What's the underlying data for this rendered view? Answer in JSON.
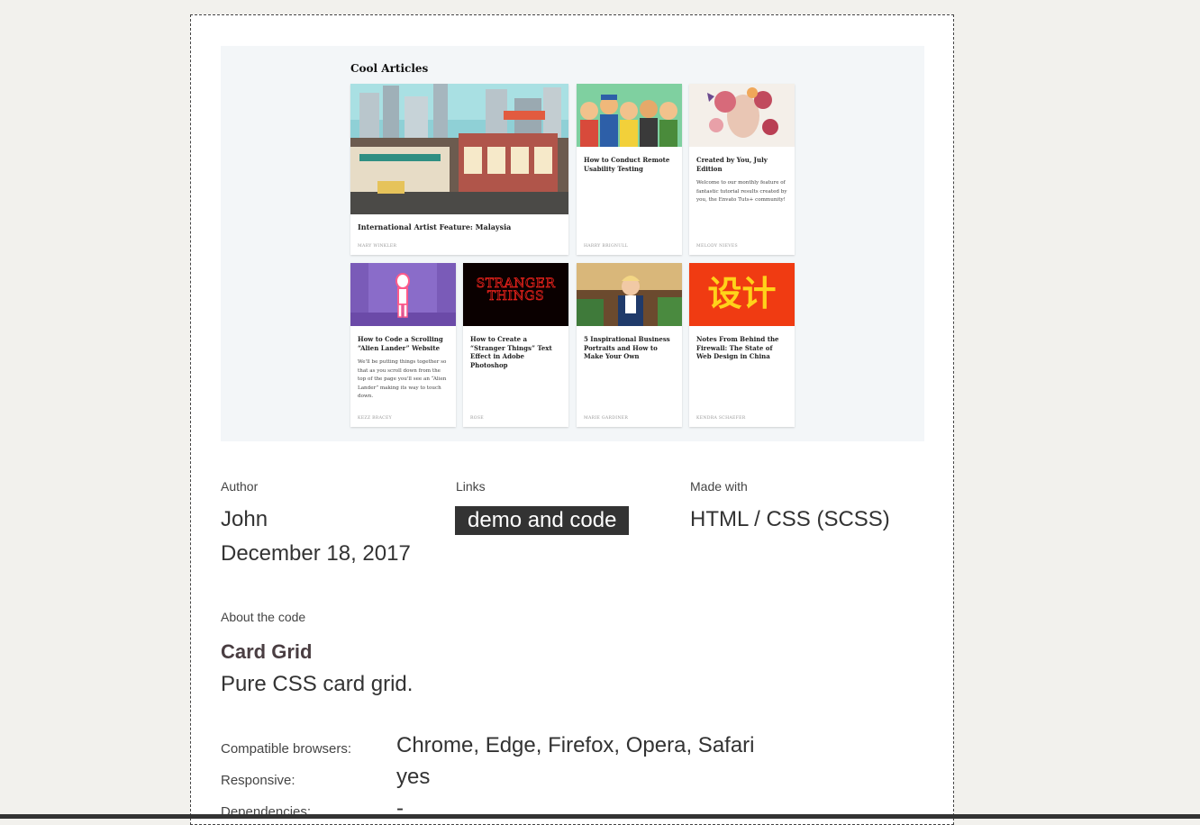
{
  "preview": {
    "heading": "Cool Articles",
    "cards": [
      {
        "title": "International Artist Feature: Malaysia",
        "description": "",
        "author": "MARY WINKLER",
        "image": "city-illustration"
      },
      {
        "title": "How to Conduct Remote Usability Testing",
        "description": "",
        "author": "HARRY BRIGNULL",
        "image": "cartoon-people"
      },
      {
        "title": "Created by You, July Edition",
        "description": "Welcome to our monthly feature of fantastic tutorial results created by you, the Envato Tuts+ community!",
        "author": "MELODY NIEVES",
        "image": "floral-portrait"
      },
      {
        "title": "How to Code a Scrolling “Alien Lander” Website",
        "description": "We'll be putting things together so that as you scroll down from the top of the page you'll see an “Alien Lander” making its way to touch down.",
        "author": "KEZZ BRACEY",
        "image": "alien-figure"
      },
      {
        "title": "How to Create a “Stranger Things” Text Effect in Adobe Photoshop",
        "description": "",
        "author": "ROSE",
        "image": "stranger-things-logo",
        "image_text": "STRANGER THINGS"
      },
      {
        "title": "5 Inspirational Business Portraits and How to Make Your Own",
        "description": "",
        "author": "MARIE GARDINER",
        "image": "business-portrait"
      },
      {
        "title": "Notes From Behind the Firewall: The State of Web Design in China",
        "description": "",
        "author": "KENDRA SCHAEFER",
        "image": "chinese-characters",
        "image_text": "设计"
      }
    ]
  },
  "meta": {
    "author_label": "Author",
    "author_name": "John",
    "date": "December 18, 2017",
    "links_label": "Links",
    "link_text": "demo and code",
    "made_with_label": "Made with",
    "made_with_value": "HTML / CSS (SCSS)"
  },
  "about": {
    "label": "About the code",
    "title": "Card Grid",
    "description": "Pure CSS card grid."
  },
  "details": {
    "browsers_label": "Compatible browsers:",
    "browsers_value": "Chrome, Edge, Firefox, Opera, Safari",
    "responsive_label": "Responsive:",
    "responsive_value": "yes",
    "dependencies_label": "Dependencies:",
    "dependencies_value": "-"
  },
  "colors": {
    "page_bg": "#f2f1ed",
    "link_bg": "#333333",
    "title_color": "#4a3e42",
    "china_red": "#f03b12",
    "china_yellow": "#ffd21a"
  }
}
